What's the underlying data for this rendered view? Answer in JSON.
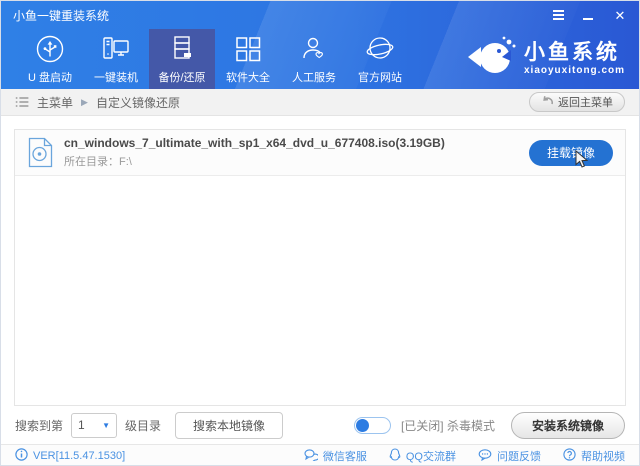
{
  "colors": {
    "accent_blue": "#2d7ce2",
    "header_dark": "#2a58d4",
    "selected_tab": "#4458a8",
    "link_blue": "#4a92e2"
  },
  "titlebar": {
    "title": "小鱼一键重装系统"
  },
  "nav": {
    "items": [
      {
        "label": "U 盘启动"
      },
      {
        "label": "一键装机"
      },
      {
        "label": "备份/还原",
        "selected": true
      },
      {
        "label": "软件大全"
      },
      {
        "label": "人工服务"
      },
      {
        "label": "官方网站"
      }
    ],
    "logo": {
      "name": "小鱼系统",
      "domain": "xiaoyuxitong.com"
    }
  },
  "breadcrumb": {
    "root": "主菜单",
    "current": "自定义镜像还原",
    "back_button": "返回主菜单"
  },
  "image_list": {
    "items": [
      {
        "filename": "cn_windows_7_ultimate_with_sp1_x64_dvd_u_677408.iso(3.19GB)",
        "location": "所在目录：F:\\",
        "action_label": "挂载镜像"
      }
    ]
  },
  "bottom_bar": {
    "search_depth_prefix": "搜索到第",
    "depth_value": "1",
    "search_depth_suffix": "级目录",
    "search_local_button": "搜索本地镜像",
    "antivirus_label": "[已关闭] 杀毒模式",
    "install_button": "安装系统镜像"
  },
  "footer": {
    "version": "VER[11.5.47.1530]",
    "links": [
      {
        "label": "微信客服"
      },
      {
        "label": "QQ交流群"
      },
      {
        "label": "问题反馈"
      },
      {
        "label": "帮助视频"
      }
    ]
  }
}
